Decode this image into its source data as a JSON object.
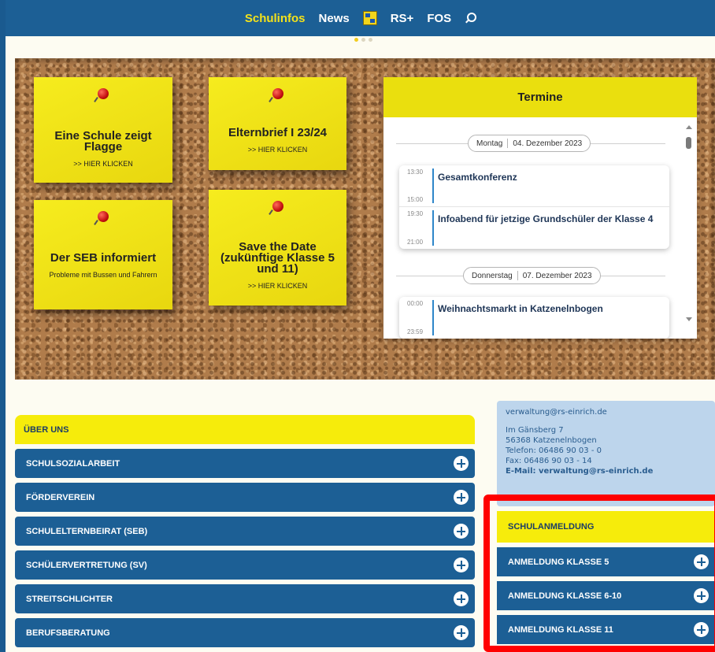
{
  "nav": {
    "items": [
      "Schulinfos",
      "News",
      "RS+",
      "FOS"
    ],
    "active": "Schulinfos",
    "icons": [
      "school-crest-icon",
      "search-icon"
    ]
  },
  "notes": [
    {
      "title": "Eine Schule zeigt Flagge",
      "sub": ">> HIER KLICKEN"
    },
    {
      "title": "Elternbrief I 23/24",
      "sub": ">> HIER KLICKEN"
    },
    {
      "title": "Der SEB informiert",
      "sub": "Probleme mit Bussen und Fahrern"
    },
    {
      "title": "Save the Date (zukünftige Klasse 5 und 11)",
      "sub": ">> HIER KLICKEN"
    }
  ],
  "termine": {
    "title": "Termine",
    "days": [
      {
        "weekday": "Montag",
        "date": "04. Dezember 2023",
        "events": [
          {
            "start": "13:30",
            "end": "15:00",
            "title": "Gesamtkonferenz"
          },
          {
            "start": "19:30",
            "end": "21:00",
            "title": "Infoabend für jetzige Grundschüler der Klasse 4"
          }
        ]
      },
      {
        "weekday": "Donnerstag",
        "date": "07. Dezember 2023",
        "events": [
          {
            "start": "00:00",
            "end": "23:59",
            "title": "Weihnachtsmarkt in Katzenelnbogen"
          }
        ]
      }
    ]
  },
  "ueber_uns": {
    "header": "ÜBER UNS",
    "items": [
      "SCHULSOZIALARBEIT",
      "FÖRDERVEREIN",
      "SCHULELTERNBEIRAT (SEB)",
      "SCHÜLERVERTRETUNG (SV)",
      "STREITSCHLICHTER",
      "BERUFSBERATUNG"
    ]
  },
  "contact": {
    "email_top": "verwaltung@rs-einrich.de",
    "street": "Im Gänsberg 7",
    "city": "56368 Katzenelnbogen",
    "phone": "Telefon: 06486 90 03 - 0",
    "fax": "Fax: 06486 90 03 - 14",
    "email": "E-Mail: verwaltung@rs-einrich.de"
  },
  "schulanmeldung": {
    "header": "SCHULANMELDUNG",
    "items": [
      "ANMELDUNG KLASSE 5",
      "ANMELDUNG KLASSE 6-10",
      "ANMELDUNG KLASSE 11"
    ]
  },
  "colors": {
    "nav_blue": "#1c5f95",
    "note_yellow": "#f6ec1e",
    "highlight_red": "#ff0000"
  }
}
